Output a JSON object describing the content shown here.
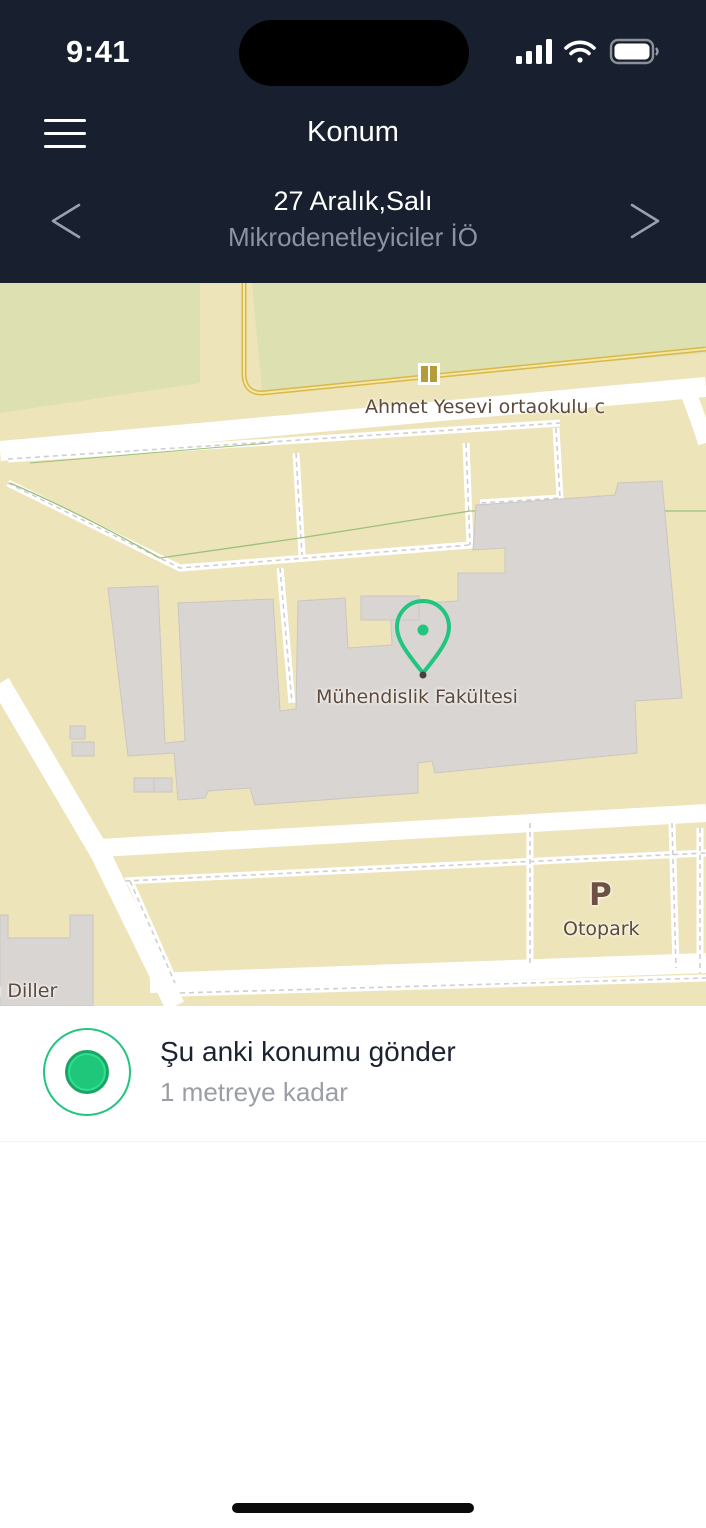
{
  "status_bar": {
    "time": "9:41"
  },
  "header": {
    "title": "Konum",
    "date": "27 Aralık,Salı",
    "course": "Mikrodenetleyiciler İÖ",
    "icons": {
      "menu": "hamburger-menu-icon",
      "prev": "chevron-left-icon",
      "next": "chevron-right-icon"
    }
  },
  "map": {
    "labels": {
      "school": "Ahmet Yesevi ortaokulu c",
      "faculty": "Mühendislik Fakültesi",
      "parking_symbol": "P",
      "parking": "Otopark",
      "diller": "ı Diller"
    },
    "marker_color": "#21c57f"
  },
  "location_option": {
    "title": "Şu anki konumu gönder",
    "subtitle": "1 metreye kadar",
    "accent": "#1fc77b"
  },
  "colors": {
    "header_bg": "#18202f",
    "map_land": "#ede4b9",
    "building": "#d9d5d2"
  }
}
